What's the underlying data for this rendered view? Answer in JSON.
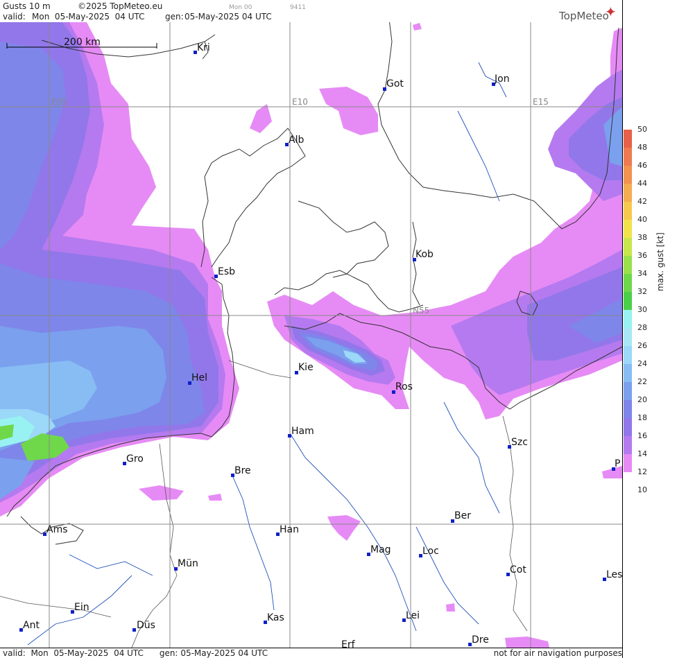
{
  "header": {
    "product": "Gusts 10 m",
    "copyright": "©2025 TopMeteo.eu",
    "faint_run": "Mon 00",
    "faint_code": "9411",
    "valid_label": "valid:",
    "valid_value": "Mon  05-May-2025  04 UTC",
    "gen_label": "gen:",
    "gen_value": "05-May-2025 04 UTC"
  },
  "brand": {
    "name": "TopMeteo",
    "icon": "compass-star-icon"
  },
  "scale_bar": {
    "label": "200 km"
  },
  "grid_labels": {
    "e05": "E05",
    "e10": "E10",
    "e15": "E15",
    "n55": "N55"
  },
  "cities": [
    {
      "id": "kri",
      "name": "Kri"
    },
    {
      "id": "got",
      "name": "Got"
    },
    {
      "id": "jon",
      "name": "Jon"
    },
    {
      "id": "alb",
      "name": "Alb"
    },
    {
      "id": "kob",
      "name": "Kob"
    },
    {
      "id": "esb",
      "name": "Esb"
    },
    {
      "id": "kie",
      "name": "Kie"
    },
    {
      "id": "ros",
      "name": "Ros"
    },
    {
      "id": "hel",
      "name": "Hel"
    },
    {
      "id": "ham",
      "name": "Ham"
    },
    {
      "id": "szc",
      "name": "Szc"
    },
    {
      "id": "gro",
      "name": "Gro"
    },
    {
      "id": "bre",
      "name": "Bre"
    },
    {
      "id": "p",
      "name": "P"
    },
    {
      "id": "ber",
      "name": "Ber"
    },
    {
      "id": "ams",
      "name": "Ams"
    },
    {
      "id": "han",
      "name": "Han"
    },
    {
      "id": "mag",
      "name": "Mag"
    },
    {
      "id": "loc",
      "name": "Loc"
    },
    {
      "id": "mun",
      "name": "Mün"
    },
    {
      "id": "cot",
      "name": "Cot"
    },
    {
      "id": "les",
      "name": "Les"
    },
    {
      "id": "ein",
      "name": "Ein"
    },
    {
      "id": "kas",
      "name": "Kas"
    },
    {
      "id": "lei",
      "name": "Lei"
    },
    {
      "id": "ant",
      "name": "Ant"
    },
    {
      "id": "dus",
      "name": "Düs"
    },
    {
      "id": "erf",
      "name": "Erf"
    },
    {
      "id": "dre",
      "name": "Dre"
    }
  ],
  "legend": {
    "title": "max. gust [kt]",
    "ticks": [
      "50",
      "48",
      "46",
      "44",
      "42",
      "40",
      "38",
      "36",
      "34",
      "32",
      "30",
      "28",
      "26",
      "24",
      "22",
      "20",
      "18",
      "16",
      "14",
      "12",
      "10"
    ],
    "colors": [
      "#e8604a",
      "#ef7a52",
      "#f29350",
      "#f4ad50",
      "#f6c94e",
      "#f2e24a",
      "#c8e64a",
      "#9ae04a",
      "#6fd84a",
      "#4cd04a",
      "#98f2f2",
      "#a8e8f6",
      "#9cd8f8",
      "#88bdf4",
      "#7ba0ee",
      "#7e86ea",
      "#9277ea",
      "#b57aef",
      "#e68bf5"
    ]
  },
  "footer": {
    "valid_label": "valid:",
    "valid_value": "Mon  05-May-2025  04 UTC",
    "gen_label": "gen:",
    "gen_value": "05-May-2025 04 UTC",
    "disclaimer": "not for air navigation purposes"
  }
}
